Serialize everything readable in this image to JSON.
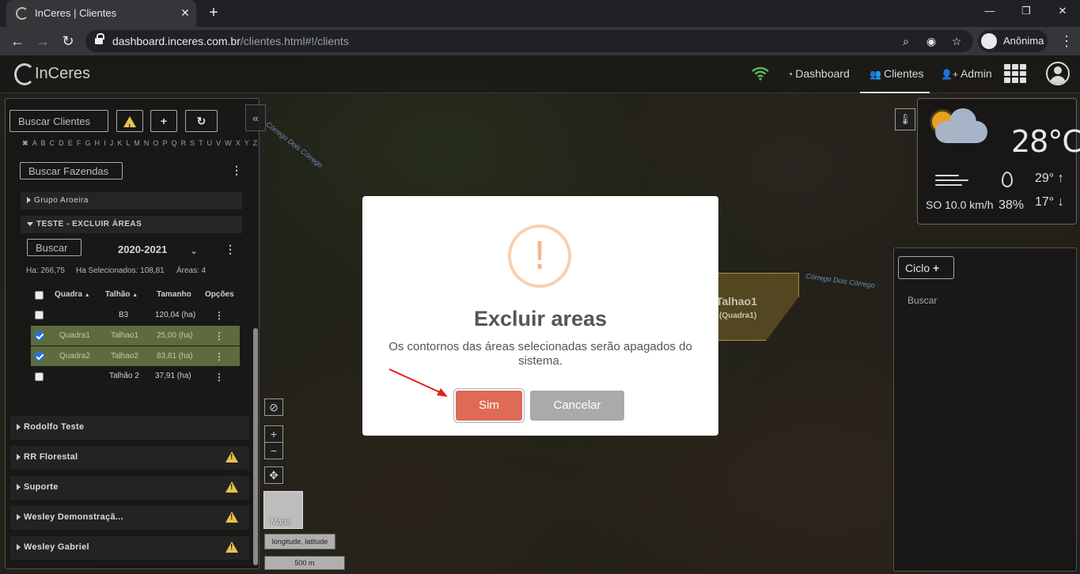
{
  "browser": {
    "tab_title": "InCeres | Clientes",
    "url_host": "dashboard.inceres.com.br",
    "url_path": "/clientes.html#!/clients",
    "profile_label": "Anônima"
  },
  "app": {
    "logo_text": "InCeres",
    "nav": {
      "dashboard": "Dashboard",
      "clientes": "Clientes",
      "admin": "Admin"
    }
  },
  "left_panel": {
    "search_clients_placeholder": "Buscar Clientes",
    "alphabet": "A B C D E F G H I J K L M N O P Q R S T U V W X Y Z",
    "search_farms_placeholder": "Buscar Fazendas",
    "groups": [
      {
        "label": "Grupo Aroeira",
        "expanded": false
      },
      {
        "label": "TESTE - EXCLUIR ÁREAS",
        "expanded": true
      }
    ],
    "area_search_placeholder": "Buscar",
    "season": "2020-2021",
    "stats": {
      "ha": "Ha: 266,75",
      "ha_selected": "Ha Selecionados: 108,81",
      "areas": "Áreas: 4"
    },
    "table": {
      "headers": [
        "Quadra",
        "Talhão",
        "Tamanho",
        "Opções"
      ],
      "rows": [
        {
          "quadra": "",
          "talhao": "B3",
          "tamanho": "120,04 (ha)",
          "selected": false
        },
        {
          "quadra": "Quadra1",
          "talhao": "Talhao1",
          "tamanho": "25,00 (ha)",
          "selected": true
        },
        {
          "quadra": "Quadra2",
          "talhao": "Talhao2",
          "tamanho": "83,81 (ha)",
          "selected": true
        },
        {
          "quadra": "",
          "talhao": "Talhão 2",
          "tamanho": "37,91 (ha)",
          "selected": false
        }
      ]
    },
    "clients": [
      {
        "label": "Rodolfo Teste",
        "warning": false
      },
      {
        "label": "RR Florestal",
        "warning": true
      },
      {
        "label": "Suporte",
        "warning": true
      },
      {
        "label": "Wesley Demonstraçã...",
        "warning": true
      },
      {
        "label": "Wesley Gabriel",
        "warning": true
      }
    ]
  },
  "map": {
    "stream_labels": [
      "Córrego Dois Córrego",
      "Córrego Dois Córrego"
    ],
    "field_label": "Talhao1",
    "field_sublabel": "(Quadra1)",
    "thumb_label": "Mapa",
    "coord_label": "longitude, latitude",
    "scale_label": "500 m"
  },
  "weather": {
    "temperature": "28°C",
    "wind": "SO 10.0 km/h",
    "humidity": "38%",
    "max": "29°",
    "min": "17°"
  },
  "right_panel": {
    "ciclo_label": "Ciclo",
    "buscar_label": "Buscar"
  },
  "modal": {
    "title": "Excluir areas",
    "body": "Os contornos das áreas selecionadas serão apagados do sistema.",
    "confirm": "Sim",
    "cancel": "Cancelar"
  },
  "colors": {
    "confirm_button": "#dd6b55",
    "cancel_button": "#aaaaaa",
    "selected_row": "#5d6b3e",
    "warning_icon": "#e8c34a",
    "annotation_arrow": "#e02020"
  }
}
